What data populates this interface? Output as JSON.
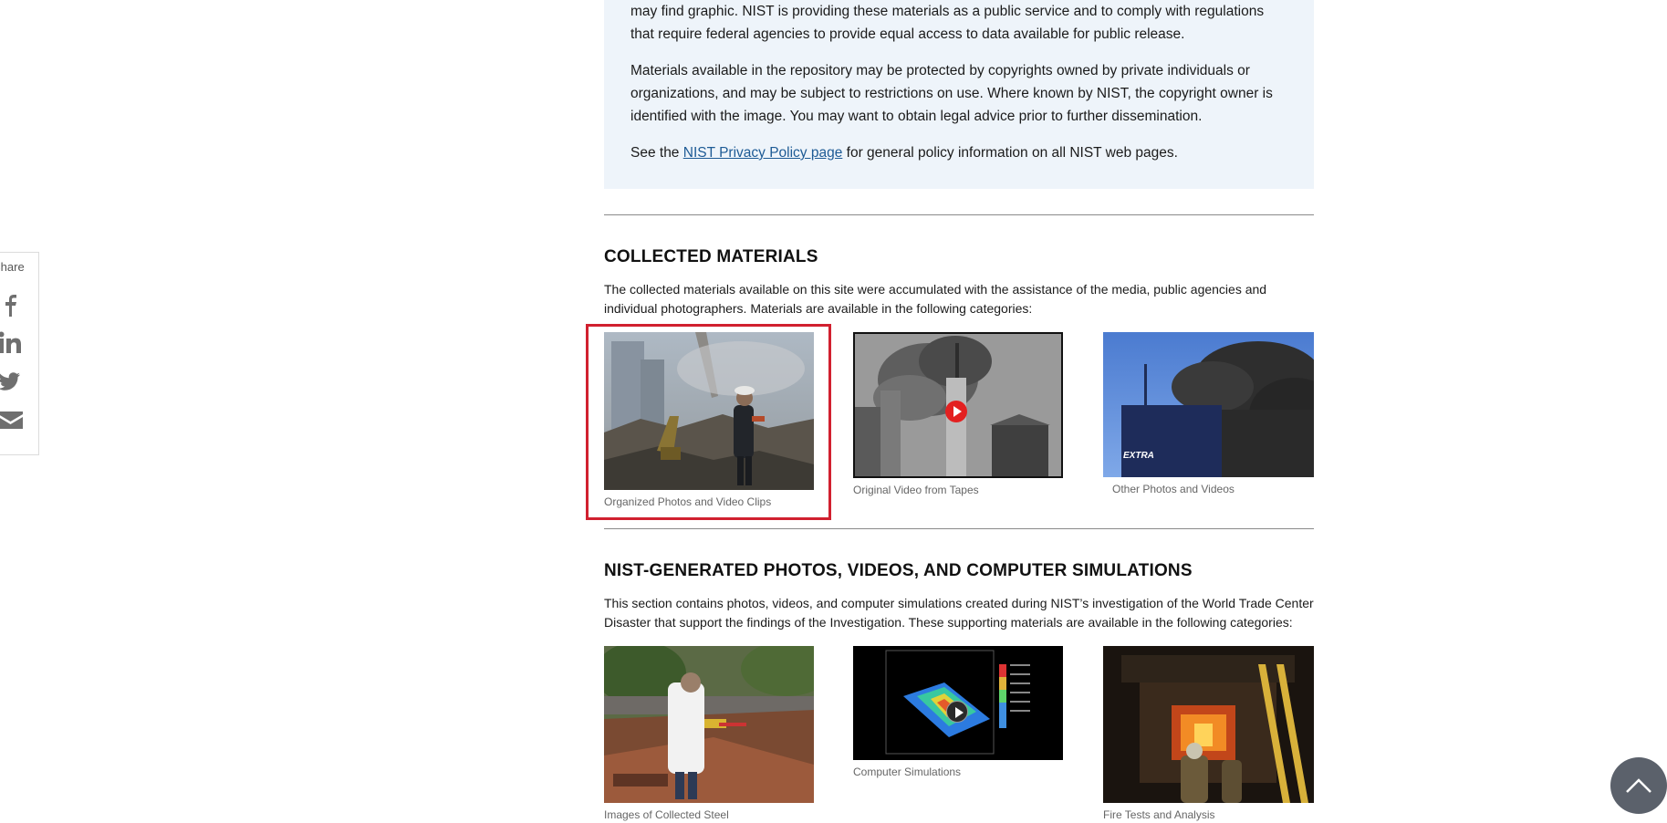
{
  "share": {
    "label": "Share",
    "icons": [
      "facebook-icon",
      "linkedin-icon",
      "twitter-icon",
      "email-icon"
    ]
  },
  "notice": {
    "p1": "may find graphic. NIST is providing these materials as a public service and to comply with regulations that require federal agencies to provide equal access to data available for public release.",
    "p2": "Materials available in the repository may be protected by copyrights owned by private individuals or organizations, and may be subject to restrictions on use. Where known by NIST, the copyright owner is identified with the image. You may want to obtain legal advice prior to further dissemination.",
    "p3_before": "See the ",
    "p3_link": "NIST Privacy Policy page",
    "p3_after": " for general policy information on all NIST web pages."
  },
  "collected": {
    "heading": "COLLECTED MATERIALS",
    "intro": "The collected materials available on this site were accumulated with the assistance of the media, public agencies and individual photographers.  Materials are available in the following categories:",
    "tiles": [
      {
        "caption": "Organized Photos and Video Clips"
      },
      {
        "caption": "Original Video from Tapes"
      },
      {
        "caption": "Other Photos and Videos",
        "overlay_text": "EXTRA"
      }
    ]
  },
  "generated": {
    "heading": "NIST-GENERATED PHOTOS, VIDEOS, AND COMPUTER SIMULATIONS",
    "intro": "This section contains photos, videos, and computer simulations created during NIST’s investigation of the World Trade Center Disaster that support the findings of the Investigation.  These supporting materials are available in the following categories:",
    "tiles": [
      {
        "caption": "Images of Collected Steel"
      },
      {
        "caption": "Computer Simulations"
      },
      {
        "caption": "Fire Tests and Analysis"
      }
    ]
  },
  "colors": {
    "link": "#1e5b95",
    "highlight": "#d1202f",
    "notice_bg": "#eef4fa",
    "back_to_top": "#5b616b"
  },
  "back_to_top_icon": "chevron-up-icon"
}
